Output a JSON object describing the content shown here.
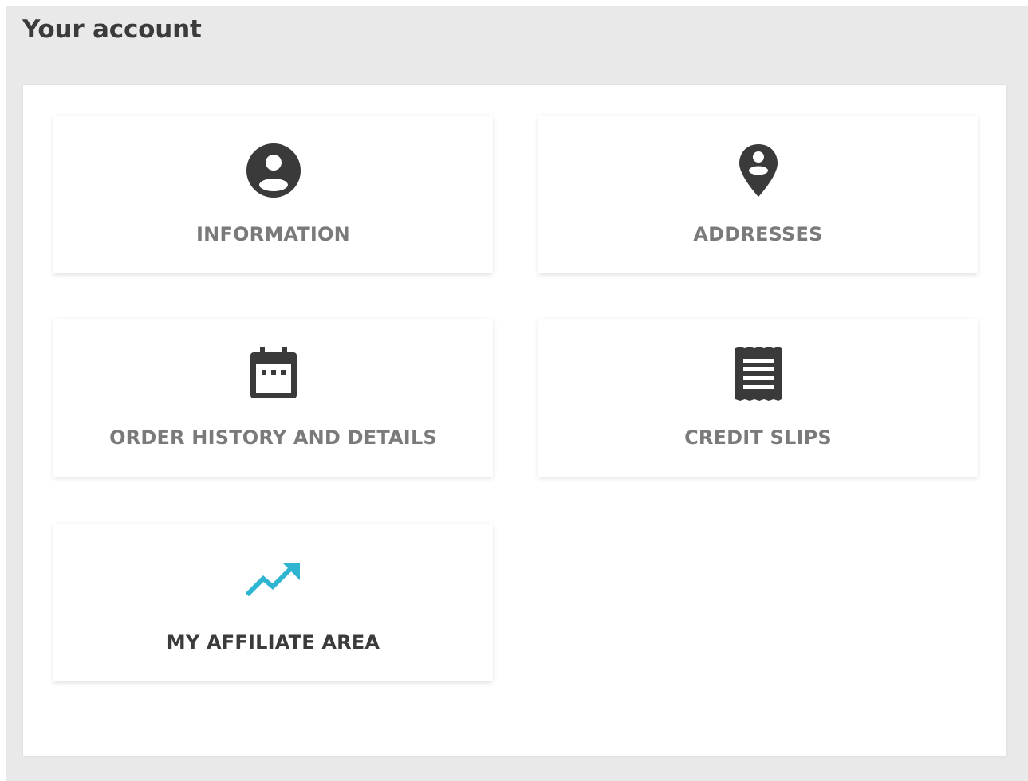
{
  "page": {
    "title": "Your account"
  },
  "tiles": [
    {
      "label": "INFORMATION",
      "icon": "account-circle-icon"
    },
    {
      "label": "ADDRESSES",
      "icon": "location-pin-icon"
    },
    {
      "label": "ORDER HISTORY AND DETAILS",
      "icon": "calendar-icon"
    },
    {
      "label": "CREDIT SLIPS",
      "icon": "receipt-icon"
    },
    {
      "label": "MY AFFILIATE AREA",
      "icon": "trending-up-icon"
    }
  ],
  "colors": {
    "icon_dark": "#3a3a3a",
    "label_muted": "#7a7a7a",
    "label_dark": "#3b3b3b",
    "accent": "#2fb5d2",
    "background": "#e9e9e9"
  }
}
